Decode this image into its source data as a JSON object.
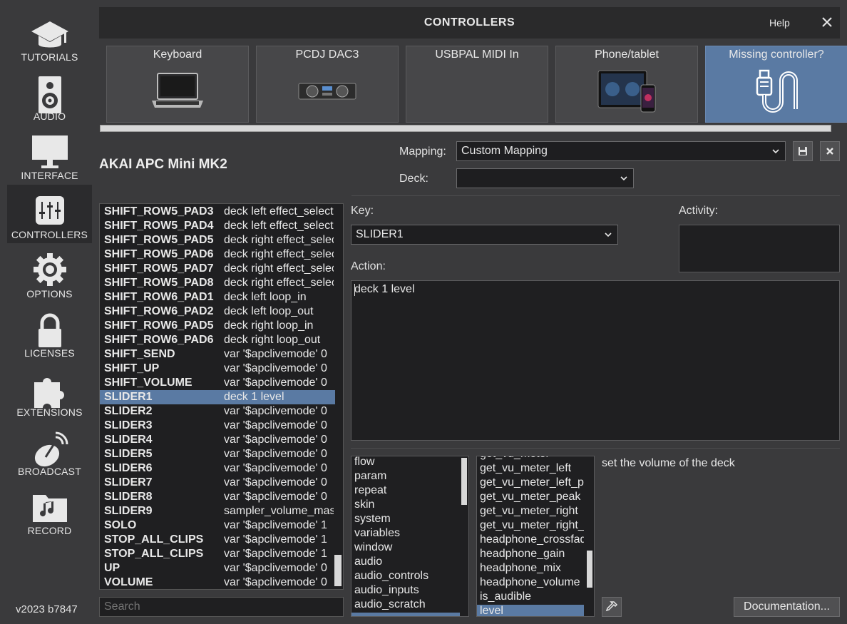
{
  "sidebar": {
    "items": [
      {
        "label": "TUTORIALS",
        "icon": "graduation-cap-icon"
      },
      {
        "label": "AUDIO",
        "icon": "speaker-icon"
      },
      {
        "label": "INTERFACE",
        "icon": "monitor-icon"
      },
      {
        "label": "CONTROLLERS",
        "icon": "sliders-icon",
        "active": true
      },
      {
        "label": "OPTIONS",
        "icon": "gear-icon"
      },
      {
        "label": "LICENSES",
        "icon": "lock-icon"
      },
      {
        "label": "EXTENSIONS",
        "icon": "puzzle-icon"
      },
      {
        "label": "BROADCAST",
        "icon": "satellite-dish-icon"
      },
      {
        "label": "RECORD",
        "icon": "music-folder-icon"
      }
    ],
    "version": "v2023 b7847"
  },
  "window": {
    "title": "CONTROLLERS",
    "help_label": "Help"
  },
  "devices": [
    {
      "label": "Keyboard",
      "icon": "laptop-icon"
    },
    {
      "label": "PCDJ DAC3",
      "icon": "dj-controller-icon"
    },
    {
      "label": "USBPAL MIDI In",
      "icon": ""
    },
    {
      "label": "Phone/tablet",
      "icon": "tablet-phone-icon"
    },
    {
      "label": "Missing controller?",
      "icon": "usb-cable-icon"
    }
  ],
  "device_name": "AKAI APC Mini MK2",
  "mapping": {
    "mapping_label": "Mapping:",
    "mapping_value": "Custom Mapping",
    "deck_label": "Deck:",
    "deck_value": ""
  },
  "keys": [
    {
      "name": "SHIFT_ROW5_PAD3",
      "action": "deck left effect_select"
    },
    {
      "name": "SHIFT_ROW5_PAD4",
      "action": "deck left effect_select"
    },
    {
      "name": "SHIFT_ROW5_PAD5",
      "action": "deck right effect_select"
    },
    {
      "name": "SHIFT_ROW5_PAD6",
      "action": "deck right effect_select"
    },
    {
      "name": "SHIFT_ROW5_PAD7",
      "action": "deck right effect_select"
    },
    {
      "name": "SHIFT_ROW5_PAD8",
      "action": "deck right effect_select"
    },
    {
      "name": "SHIFT_ROW6_PAD1",
      "action": "deck left loop_in"
    },
    {
      "name": "SHIFT_ROW6_PAD2",
      "action": "deck left loop_out"
    },
    {
      "name": "SHIFT_ROW6_PAD5",
      "action": "deck right loop_in"
    },
    {
      "name": "SHIFT_ROW6_PAD6",
      "action": "deck right loop_out"
    },
    {
      "name": "SHIFT_SEND",
      "action": "var '$apclivemode' 0"
    },
    {
      "name": "SHIFT_UP",
      "action": "var '$apclivemode' 0"
    },
    {
      "name": "SHIFT_VOLUME",
      "action": "var '$apclivemode' 0"
    },
    {
      "name": "SLIDER1",
      "action": "deck  1 level",
      "selected": true
    },
    {
      "name": "SLIDER2",
      "action": "var '$apclivemode' 0"
    },
    {
      "name": "SLIDER3",
      "action": "var '$apclivemode' 0"
    },
    {
      "name": "SLIDER4",
      "action": "var '$apclivemode' 0"
    },
    {
      "name": "SLIDER5",
      "action": "var '$apclivemode' 0"
    },
    {
      "name": "SLIDER6",
      "action": "var '$apclivemode' 0"
    },
    {
      "name": "SLIDER7",
      "action": "var '$apclivemode' 0"
    },
    {
      "name": "SLIDER8",
      "action": "var '$apclivemode' 0"
    },
    {
      "name": "SLIDER9",
      "action": "sampler_volume_master"
    },
    {
      "name": "SOLO",
      "action": "var '$apclivemode' 1"
    },
    {
      "name": "STOP_ALL_CLIPS",
      "action": "var '$apclivemode' 1"
    },
    {
      "name": "STOP_ALL_CLIPS",
      "action": "var '$apclivemode' 1"
    },
    {
      "name": "UP",
      "action": "var '$apclivemode' 0"
    },
    {
      "name": "VOLUME",
      "action": "var '$apclivemode' 0"
    }
  ],
  "search": {
    "placeholder": "Search"
  },
  "editor": {
    "key_label": "Key:",
    "key_value": "SLIDER1",
    "activity_label": "Activity:",
    "action_label": "Action:",
    "action_value": "deck  1 level"
  },
  "categories": [
    "flow",
    "param",
    "repeat",
    "skin",
    "system",
    "variables",
    "window",
    "audio",
    "audio_controls",
    "audio_inputs",
    "audio_scratch"
  ],
  "verbs": [
    {
      "label": "get_vu_meter"
    },
    {
      "label": "get_vu_meter_left"
    },
    {
      "label": "get_vu_meter_left_peak"
    },
    {
      "label": "get_vu_meter_peak"
    },
    {
      "label": "get_vu_meter_right"
    },
    {
      "label": "get_vu_meter_right_peak"
    },
    {
      "label": "headphone_crossfader"
    },
    {
      "label": "headphone_gain"
    },
    {
      "label": "headphone_mix"
    },
    {
      "label": "headphone_volume"
    },
    {
      "label": "is_audible"
    },
    {
      "label": "level",
      "selected": true
    }
  ],
  "description": "set the volume of the deck",
  "documentation_label": "Documentation...",
  "colors": {
    "accent": "#5a7aa3",
    "background": "#3a3a3c",
    "panel": "#1f1f21"
  }
}
